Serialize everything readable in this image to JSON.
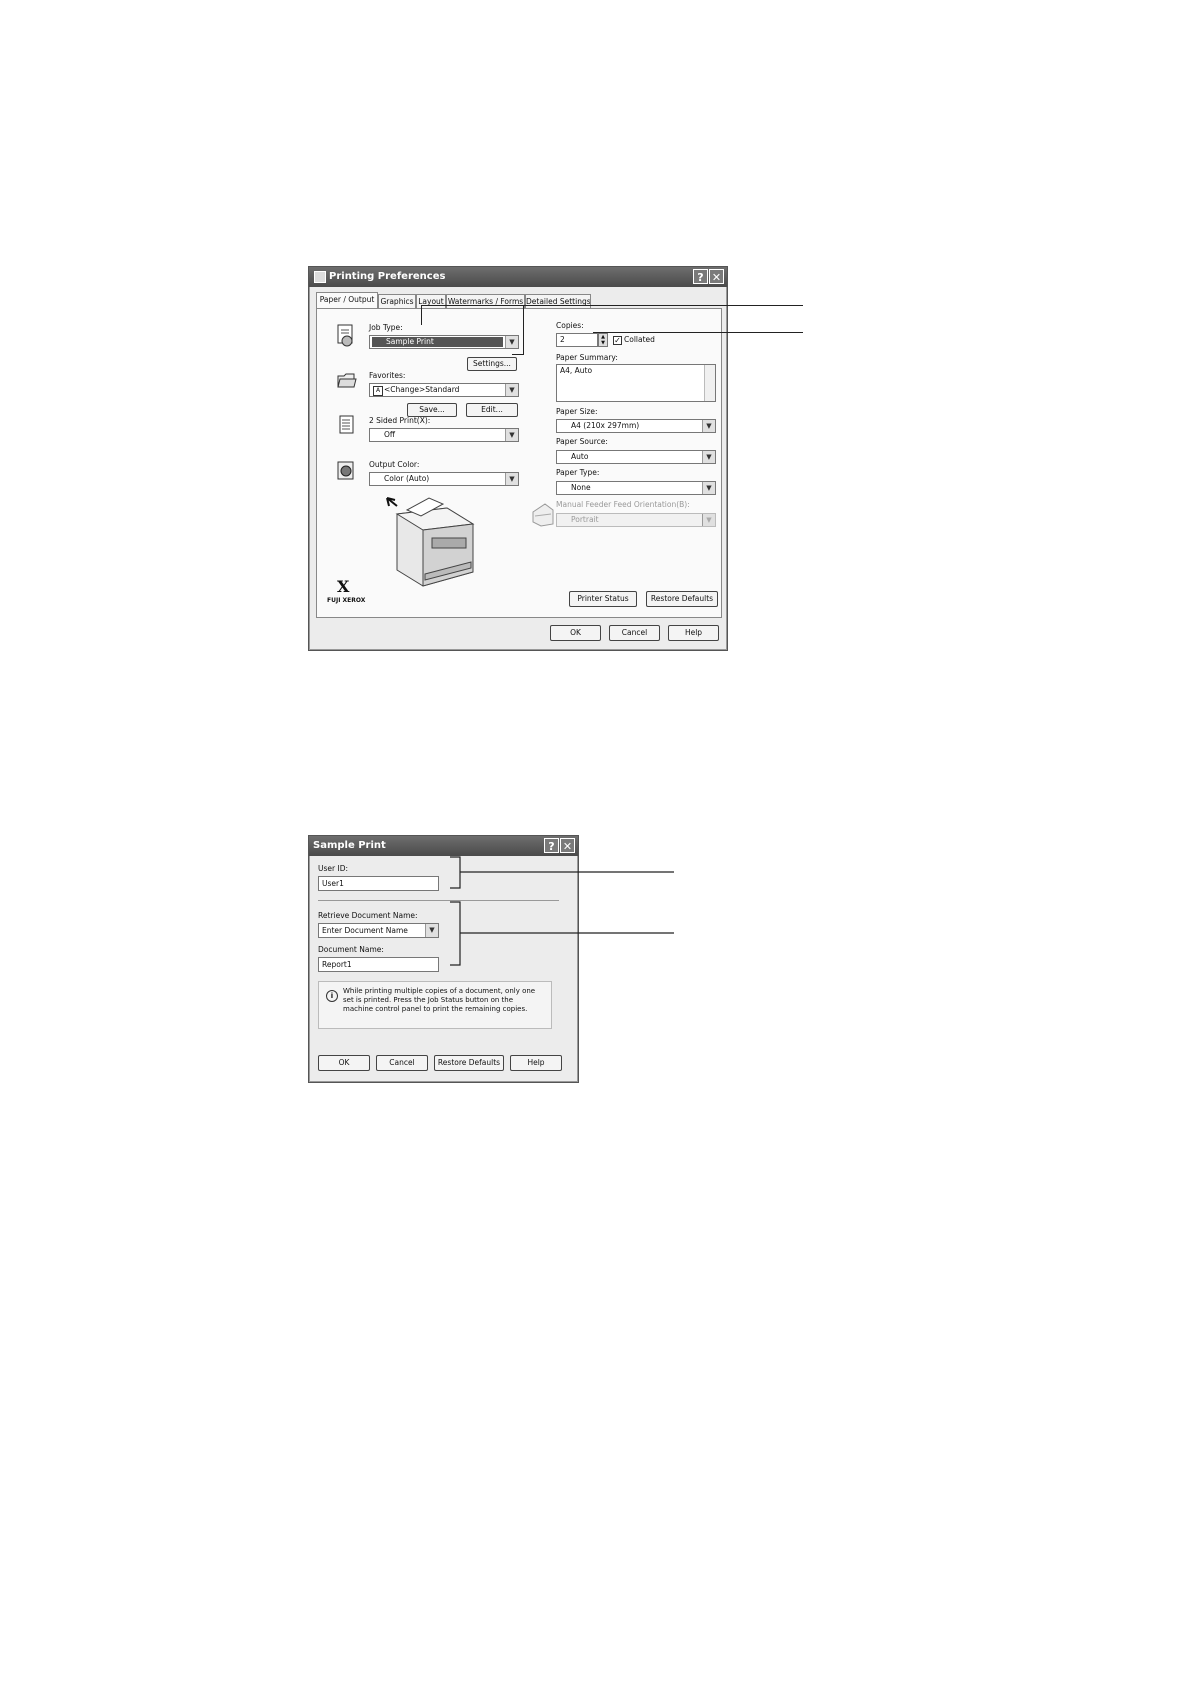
{
  "printing_prefs": {
    "title": "Printing Preferences",
    "help_button": "?",
    "close_button": "✕",
    "tabs": [
      "Paper / Output",
      "Graphics",
      "Layout",
      "Watermarks / Forms",
      "Detailed Settings"
    ],
    "job_type": {
      "label": "Job Type:",
      "value": "Sample Print"
    },
    "settings_button": "Settings...",
    "favorites": {
      "label": "Favorites:",
      "value": "<Change>Standard"
    },
    "save_button": "Save...",
    "edit_button": "Edit...",
    "two_sided": {
      "label": "2 Sided Print(X):",
      "value": "Off"
    },
    "output_color": {
      "label": "Output Color:",
      "value": "Color (Auto)"
    },
    "copies": {
      "label": "Copies:",
      "value": "2",
      "collated_label": "Collated",
      "collated_checked": true
    },
    "paper_summary": {
      "label": "Paper Summary:",
      "value": "A4, Auto"
    },
    "paper_size": {
      "label": "Paper Size:",
      "value": "A4 (210x 297mm)"
    },
    "paper_source": {
      "label": "Paper Source:",
      "value": "Auto"
    },
    "paper_type": {
      "label": "Paper Type:",
      "value": "None"
    },
    "manual_feed": {
      "label": "Manual Feeder Feed Orientation(B):",
      "value": "Portrait"
    },
    "brand": "FUJI XEROX",
    "brand_mark": "X",
    "printer_status_button": "Printer Status",
    "restore_defaults_button": "Restore Defaults",
    "ok_button": "OK",
    "cancel_button": "Cancel",
    "help_btn": "Help"
  },
  "sample_print": {
    "title": "Sample Print",
    "help_button": "?",
    "close_button": "✕",
    "user_id": {
      "label": "User ID:",
      "value": "User1"
    },
    "retrieve_doc": {
      "label": "Retrieve Document Name:",
      "value": "Enter Document Name"
    },
    "doc_name": {
      "label": "Document Name:",
      "value": "Report1"
    },
    "info_text": "While printing multiple copies of a document, only one set is printed. Press the Job Status button on the machine control panel to print the remaining copies.",
    "ok_button": "OK",
    "cancel_button": "Cancel",
    "restore_defaults_button": "Restore Defaults",
    "help_button_label": "Help"
  },
  "colors": {
    "titlebar": "#555555",
    "dialog_bg": "#ececec",
    "panel_bg": "#fafafa",
    "selection": "#555555"
  }
}
